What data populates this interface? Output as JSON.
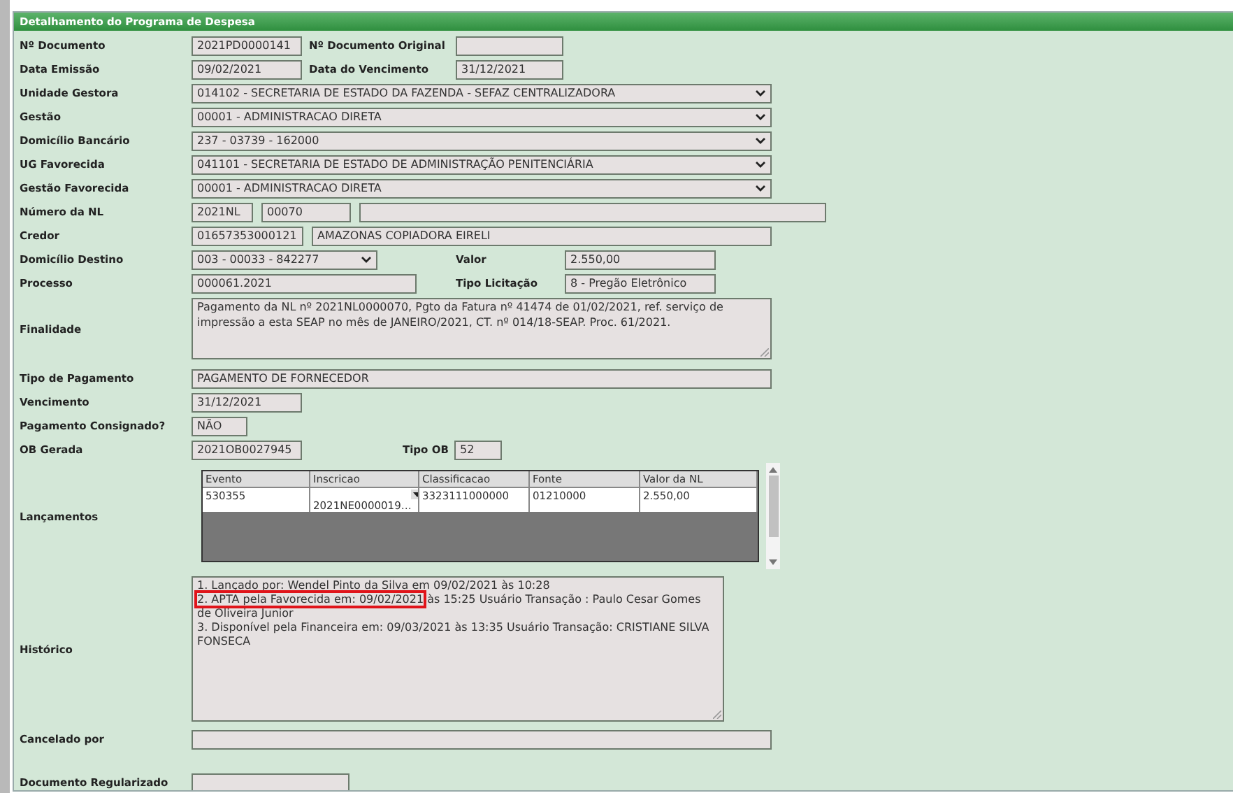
{
  "panel": {
    "title": "Detalhamento do Programa de Despesa"
  },
  "rows": [
    {
      "kind": "fields",
      "label": "Nº Documento",
      "items": [
        {
          "kind": "text",
          "value": "2021PD0000141"
        },
        {
          "kind": "label",
          "text": "Nº Documento Original"
        },
        {
          "kind": "text"
        }
      ]
    },
    {
      "kind": "fields",
      "label": "Data Emissão",
      "items": [
        {
          "kind": "text",
          "value": "09/02/2021"
        },
        {
          "kind": "label",
          "text": "Data do Vencimento"
        },
        {
          "kind": "text",
          "value": "31/12/2021"
        }
      ]
    },
    {
      "kind": "fields",
      "label": "Unidade Gestora",
      "items": [
        {
          "kind": "select",
          "value": "014102 - SECRETARIA DE ESTADO DA FAZENDA - SEFAZ CENTRALIZADORA"
        }
      ]
    },
    {
      "kind": "fields",
      "label": "Gestão",
      "items": [
        {
          "kind": "select",
          "value": "00001 - ADMINISTRACAO DIRETA"
        }
      ]
    },
    {
      "kind": "fields",
      "label": "Domicílio Bancário",
      "items": [
        {
          "kind": "select",
          "value": "237 - 03739 - 162000"
        }
      ]
    },
    {
      "kind": "fields",
      "label": "UG Favorecida",
      "items": [
        {
          "kind": "select",
          "value": "041101 - SECRETARIA DE ESTADO DE ADMINISTRAÇÃO PENITENCIÁRIA"
        }
      ]
    },
    {
      "kind": "fields",
      "label": "Gestão Favorecida",
      "items": [
        {
          "kind": "select",
          "value": "00001 - ADMINISTRACAO DIRETA"
        }
      ]
    },
    {
      "kind": "fields",
      "label": "Número da NL",
      "items": [
        {
          "kind": "text",
          "value": "2021NL"
        },
        {
          "kind": "text",
          "value": "00070"
        },
        {
          "kind": "text"
        }
      ]
    },
    {
      "kind": "fields",
      "label": "Credor",
      "items": [
        {
          "kind": "text",
          "value": "01657353000121"
        },
        {
          "kind": "text",
          "value": "AMAZONAS COPIADORA EIRELI"
        }
      ]
    },
    {
      "kind": "fields",
      "label": "Domicílio Destino",
      "items": [
        {
          "kind": "select",
          "value": "003 - 00033 - 842277"
        },
        {
          "kind": "label",
          "text": "Valor"
        },
        {
          "kind": "text",
          "value": "2.550,00"
        }
      ]
    },
    {
      "kind": "fields",
      "label": "Processo",
      "items": [
        {
          "kind": "text",
          "value": "000061.2021"
        },
        {
          "kind": "label",
          "text": "Tipo Licitação"
        },
        {
          "kind": "text",
          "value": "8 - Pregão Eletrônico"
        }
      ]
    },
    {
      "kind": "fields",
      "label": "Finalidade",
      "items": [
        {
          "kind": "textarea",
          "value": "Pagamento da NL nº 2021NL0000070, Pgto da Fatura nº 41474 de 01/02/2021, ref. serviço de impressão a esta SEAP no mês de JANEIRO/2021, CT. nº 014/18-SEAP. Proc. 61/2021."
        }
      ]
    },
    {
      "kind": "fields",
      "label": "Tipo de Pagamento",
      "items": [
        {
          "kind": "text",
          "value": "PAGAMENTO DE FORNECEDOR"
        }
      ]
    },
    {
      "kind": "fields",
      "label": "Vencimento",
      "items": [
        {
          "kind": "text",
          "value": "31/12/2021"
        }
      ]
    },
    {
      "kind": "fields",
      "label": "Pagamento Consignado?",
      "items": [
        {
          "kind": "text",
          "value": "NÃO"
        }
      ]
    },
    {
      "kind": "fields",
      "label": "OB Gerada",
      "items": [
        {
          "kind": "text",
          "value": "2021OB0027945"
        },
        {
          "kind": "label",
          "text": "Tipo OB"
        },
        {
          "kind": "text",
          "value": "52"
        }
      ]
    },
    {
      "kind": "grid",
      "label": "Lançamentos",
      "columns": [
        "Evento",
        "Inscricao",
        "Classificacao",
        "Fonte",
        "Valor da NL"
      ],
      "rows": [
        [
          {
            "kind": "text",
            "value": "530355"
          },
          {
            "kind": "select",
            "value": "2021NE0000019…"
          },
          {
            "kind": "text",
            "value": "3323111000000"
          },
          {
            "kind": "text",
            "value": "01210000"
          },
          {
            "kind": "text",
            "value": "2.550,00"
          }
        ]
      ]
    },
    {
      "kind": "history",
      "label": "Histórico",
      "entries": [
        {
          "text": "1. Lançado por: Wendel Pinto da Silva em 09/02/2021 às 10:28"
        },
        {
          "marked": "2. APTA pela Favorecida em: 09/02/2021",
          "text": " às 15:25 Usuário Transação : Paulo Cesar Gomes",
          "continued": "de Oliveira Junior"
        },
        {
          "text": "3. Disponível pela Financeira em: 09/03/2021 às 13:35 Usuário Transação: CRISTIANE SILVA FONSECA"
        }
      ]
    },
    {
      "kind": "fields",
      "label": "Cancelado por",
      "items": [
        {
          "kind": "text"
        }
      ]
    },
    {
      "kind": "fields",
      "label": "Documento Regularizado",
      "items": [
        {
          "kind": "text"
        }
      ]
    }
  ]
}
